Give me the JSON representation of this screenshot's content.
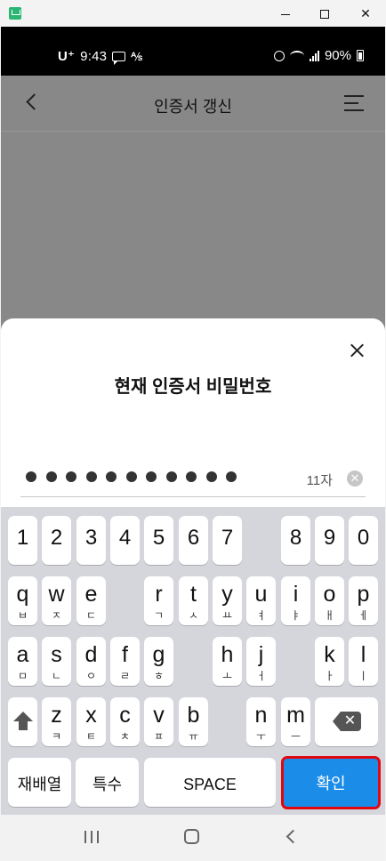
{
  "window": {
    "min_icon": "minimize-icon",
    "max_icon": "maximize-icon",
    "close_glyph": "✕"
  },
  "status_bar": {
    "carrier": "U⁺",
    "time": "9:43",
    "data_glyph": "⅍",
    "battery": "90%"
  },
  "appbar": {
    "title": "인증서 갱신"
  },
  "sheet": {
    "title": "현재 인증서 비밀번호",
    "password_length": 11,
    "count_label": "11자",
    "clear_glyph": "✕"
  },
  "keyboard": {
    "row1": [
      "1",
      "2",
      "3",
      "4",
      "5",
      "6",
      "7",
      "8",
      "9",
      "0"
    ],
    "row2": [
      {
        "main": "q",
        "sub": "ㅂ"
      },
      {
        "main": "w",
        "sub": "ㅈ"
      },
      {
        "main": "e",
        "sub": "ㄷ"
      },
      {
        "main": "r",
        "sub": "ㄱ"
      },
      {
        "main": "t",
        "sub": "ㅅ"
      },
      {
        "main": "y",
        "sub": "ㅛ"
      },
      {
        "main": "u",
        "sub": "ㅕ"
      },
      {
        "main": "i",
        "sub": "ㅑ"
      },
      {
        "main": "o",
        "sub": "ㅐ"
      },
      {
        "main": "p",
        "sub": "ㅔ"
      }
    ],
    "row3": [
      {
        "main": "a",
        "sub": "ㅁ"
      },
      {
        "main": "s",
        "sub": "ㄴ"
      },
      {
        "main": "d",
        "sub": "ㅇ"
      },
      {
        "main": "f",
        "sub": "ㄹ"
      },
      {
        "main": "g",
        "sub": "ㅎ"
      },
      {
        "main": "h",
        "sub": "ㅗ"
      },
      {
        "main": "j",
        "sub": "ㅓ"
      },
      {
        "main": "k",
        "sub": "ㅏ"
      },
      {
        "main": "l",
        "sub": "ㅣ"
      }
    ],
    "row4": [
      {
        "main": "z",
        "sub": "ㅋ"
      },
      {
        "main": "x",
        "sub": "ㅌ"
      },
      {
        "main": "c",
        "sub": "ㅊ"
      },
      {
        "main": "v",
        "sub": "ㅍ"
      },
      {
        "main": "b",
        "sub": "ㅠ"
      },
      {
        "main": "n",
        "sub": "ㅜ"
      },
      {
        "main": "m",
        "sub": "ㅡ"
      }
    ],
    "shuffle_label": "재배열",
    "special_label": "특수",
    "space_label": "SPACE",
    "confirm_label": "확인",
    "confirm_color": "#1b8de8",
    "highlight_color": "#e20812"
  }
}
